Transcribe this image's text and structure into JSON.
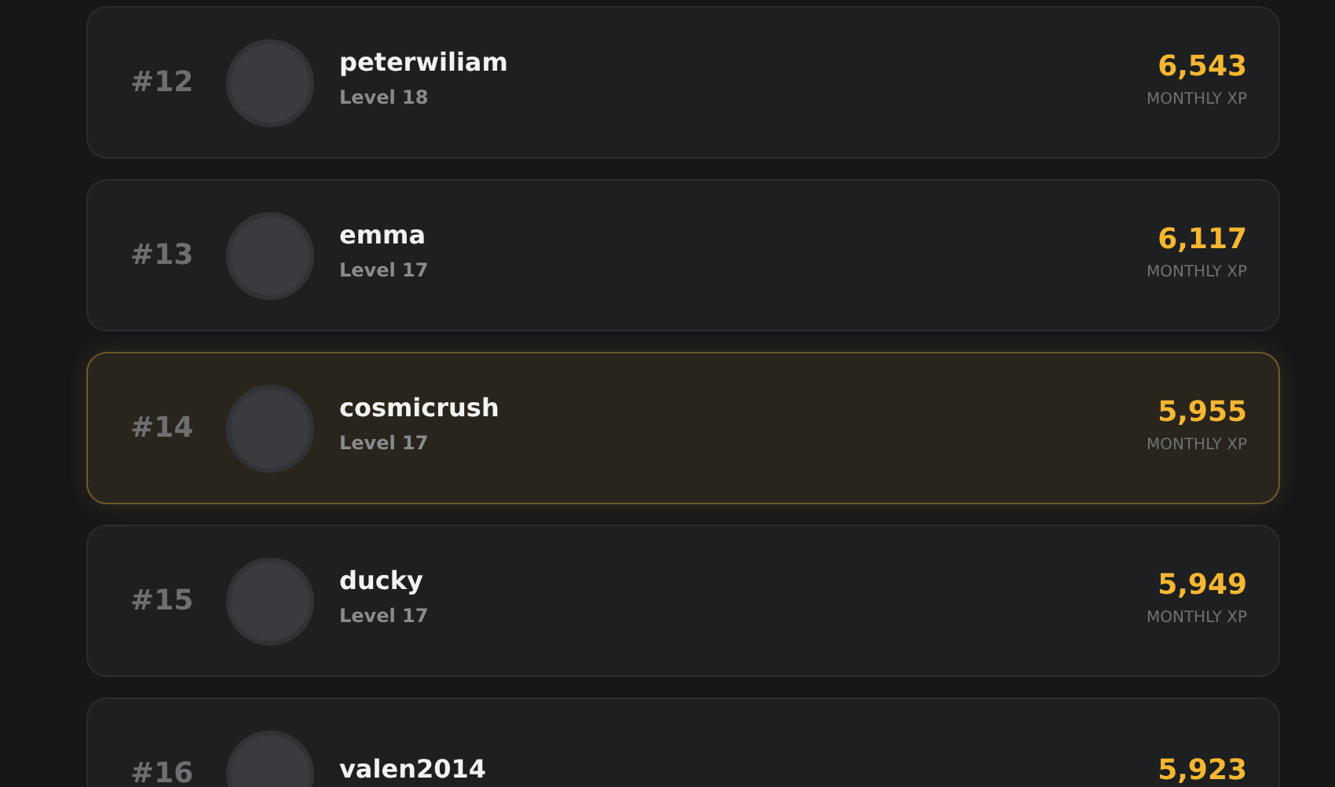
{
  "leaderboard": [
    {
      "rank": "#12",
      "name": "peterwiliam",
      "level": "Level 18",
      "xp": "6,543",
      "xp_label": "MONTHLY XP",
      "highlighted": false
    },
    {
      "rank": "#13",
      "name": "emma",
      "level": "Level 17",
      "xp": "6,117",
      "xp_label": "MONTHLY XP",
      "highlighted": false
    },
    {
      "rank": "#14",
      "name": "cosmicrush",
      "level": "Level 17",
      "xp": "5,955",
      "xp_label": "MONTHLY XP",
      "highlighted": true
    },
    {
      "rank": "#15",
      "name": "ducky",
      "level": "Level 17",
      "xp": "5,949",
      "xp_label": "MONTHLY XP",
      "highlighted": false
    },
    {
      "rank": "#16",
      "name": "valen2014",
      "xp": "5,923",
      "highlighted": false
    }
  ]
}
